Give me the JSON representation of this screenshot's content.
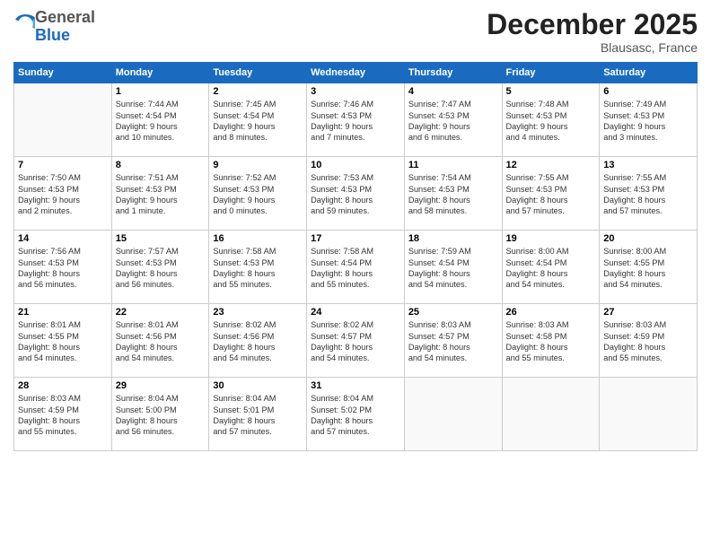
{
  "logo": {
    "general": "General",
    "blue": "Blue"
  },
  "title": "December 2025",
  "location": "Blausasc, France",
  "days_header": [
    "Sunday",
    "Monday",
    "Tuesday",
    "Wednesday",
    "Thursday",
    "Friday",
    "Saturday"
  ],
  "weeks": [
    [
      {
        "day": "",
        "info": ""
      },
      {
        "day": "1",
        "info": "Sunrise: 7:44 AM\nSunset: 4:54 PM\nDaylight: 9 hours\nand 10 minutes."
      },
      {
        "day": "2",
        "info": "Sunrise: 7:45 AM\nSunset: 4:54 PM\nDaylight: 9 hours\nand 8 minutes."
      },
      {
        "day": "3",
        "info": "Sunrise: 7:46 AM\nSunset: 4:53 PM\nDaylight: 9 hours\nand 7 minutes."
      },
      {
        "day": "4",
        "info": "Sunrise: 7:47 AM\nSunset: 4:53 PM\nDaylight: 9 hours\nand 6 minutes."
      },
      {
        "day": "5",
        "info": "Sunrise: 7:48 AM\nSunset: 4:53 PM\nDaylight: 9 hours\nand 4 minutes."
      },
      {
        "day": "6",
        "info": "Sunrise: 7:49 AM\nSunset: 4:53 PM\nDaylight: 9 hours\nand 3 minutes."
      }
    ],
    [
      {
        "day": "7",
        "info": "Sunrise: 7:50 AM\nSunset: 4:53 PM\nDaylight: 9 hours\nand 2 minutes."
      },
      {
        "day": "8",
        "info": "Sunrise: 7:51 AM\nSunset: 4:53 PM\nDaylight: 9 hours\nand 1 minute."
      },
      {
        "day": "9",
        "info": "Sunrise: 7:52 AM\nSunset: 4:53 PM\nDaylight: 9 hours\nand 0 minutes."
      },
      {
        "day": "10",
        "info": "Sunrise: 7:53 AM\nSunset: 4:53 PM\nDaylight: 8 hours\nand 59 minutes."
      },
      {
        "day": "11",
        "info": "Sunrise: 7:54 AM\nSunset: 4:53 PM\nDaylight: 8 hours\nand 58 minutes."
      },
      {
        "day": "12",
        "info": "Sunrise: 7:55 AM\nSunset: 4:53 PM\nDaylight: 8 hours\nand 57 minutes."
      },
      {
        "day": "13",
        "info": "Sunrise: 7:55 AM\nSunset: 4:53 PM\nDaylight: 8 hours\nand 57 minutes."
      }
    ],
    [
      {
        "day": "14",
        "info": "Sunrise: 7:56 AM\nSunset: 4:53 PM\nDaylight: 8 hours\nand 56 minutes."
      },
      {
        "day": "15",
        "info": "Sunrise: 7:57 AM\nSunset: 4:53 PM\nDaylight: 8 hours\nand 56 minutes."
      },
      {
        "day": "16",
        "info": "Sunrise: 7:58 AM\nSunset: 4:53 PM\nDaylight: 8 hours\nand 55 minutes."
      },
      {
        "day": "17",
        "info": "Sunrise: 7:58 AM\nSunset: 4:54 PM\nDaylight: 8 hours\nand 55 minutes."
      },
      {
        "day": "18",
        "info": "Sunrise: 7:59 AM\nSunset: 4:54 PM\nDaylight: 8 hours\nand 54 minutes."
      },
      {
        "day": "19",
        "info": "Sunrise: 8:00 AM\nSunset: 4:54 PM\nDaylight: 8 hours\nand 54 minutes."
      },
      {
        "day": "20",
        "info": "Sunrise: 8:00 AM\nSunset: 4:55 PM\nDaylight: 8 hours\nand 54 minutes."
      }
    ],
    [
      {
        "day": "21",
        "info": "Sunrise: 8:01 AM\nSunset: 4:55 PM\nDaylight: 8 hours\nand 54 minutes."
      },
      {
        "day": "22",
        "info": "Sunrise: 8:01 AM\nSunset: 4:56 PM\nDaylight: 8 hours\nand 54 minutes."
      },
      {
        "day": "23",
        "info": "Sunrise: 8:02 AM\nSunset: 4:56 PM\nDaylight: 8 hours\nand 54 minutes."
      },
      {
        "day": "24",
        "info": "Sunrise: 8:02 AM\nSunset: 4:57 PM\nDaylight: 8 hours\nand 54 minutes."
      },
      {
        "day": "25",
        "info": "Sunrise: 8:03 AM\nSunset: 4:57 PM\nDaylight: 8 hours\nand 54 minutes."
      },
      {
        "day": "26",
        "info": "Sunrise: 8:03 AM\nSunset: 4:58 PM\nDaylight: 8 hours\nand 55 minutes."
      },
      {
        "day": "27",
        "info": "Sunrise: 8:03 AM\nSunset: 4:59 PM\nDaylight: 8 hours\nand 55 minutes."
      }
    ],
    [
      {
        "day": "28",
        "info": "Sunrise: 8:03 AM\nSunset: 4:59 PM\nDaylight: 8 hours\nand 55 minutes."
      },
      {
        "day": "29",
        "info": "Sunrise: 8:04 AM\nSunset: 5:00 PM\nDaylight: 8 hours\nand 56 minutes."
      },
      {
        "day": "30",
        "info": "Sunrise: 8:04 AM\nSunset: 5:01 PM\nDaylight: 8 hours\nand 57 minutes."
      },
      {
        "day": "31",
        "info": "Sunrise: 8:04 AM\nSunset: 5:02 PM\nDaylight: 8 hours\nand 57 minutes."
      },
      {
        "day": "",
        "info": ""
      },
      {
        "day": "",
        "info": ""
      },
      {
        "day": "",
        "info": ""
      }
    ]
  ]
}
